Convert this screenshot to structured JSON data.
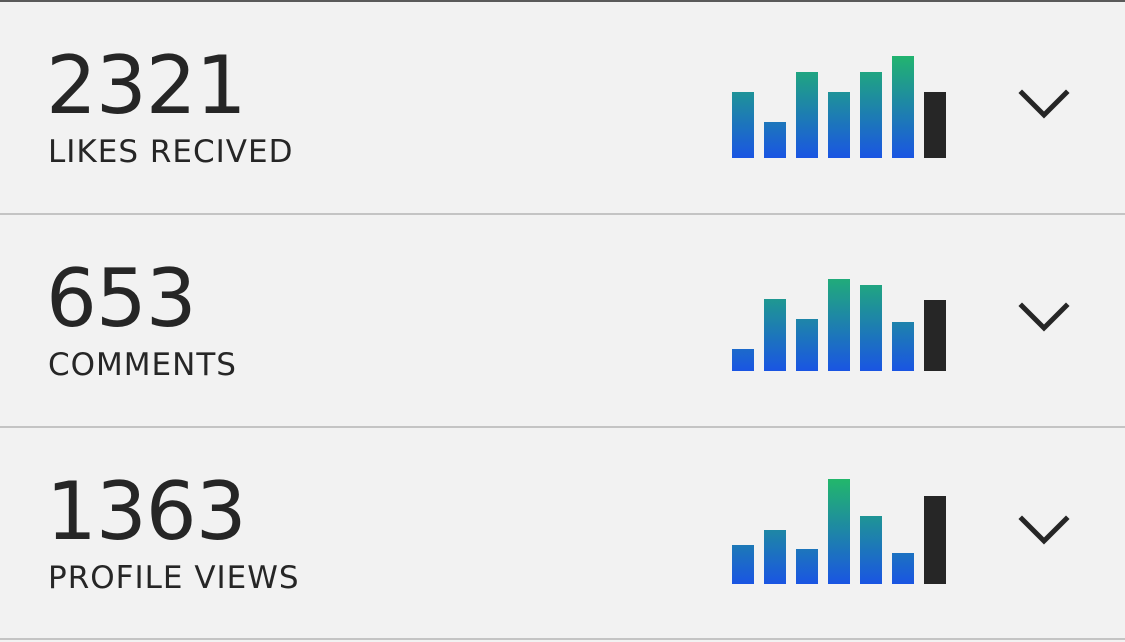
{
  "colors": {
    "bar_gradient_top": "#22b86a",
    "bar_gradient_bottom": "#1a55e3",
    "current_bar": "#262626",
    "background": "#f2f2f2",
    "divider": "#c4c4c4",
    "text": "#262626"
  },
  "stats": [
    {
      "value": "2321",
      "label": "LIKES RECIVED",
      "icon": "chevron-down-icon",
      "chart_data": {
        "type": "bar",
        "values": [
          66,
          36,
          86,
          66,
          86,
          102
        ],
        "current_value": 66
      }
    },
    {
      "value": "653",
      "label": "COMMENTS",
      "icon": "chevron-down-icon",
      "chart_data": {
        "type": "bar",
        "values": [
          22,
          72,
          52,
          92,
          86,
          49
        ],
        "current_value": 71
      }
    },
    {
      "value": "1363",
      "label": "PROFILE VIEWS",
      "icon": "chevron-down-icon",
      "chart_data": {
        "type": "bar",
        "values": [
          39,
          54,
          35,
          105,
          68,
          31
        ],
        "current_value": 88
      }
    }
  ]
}
